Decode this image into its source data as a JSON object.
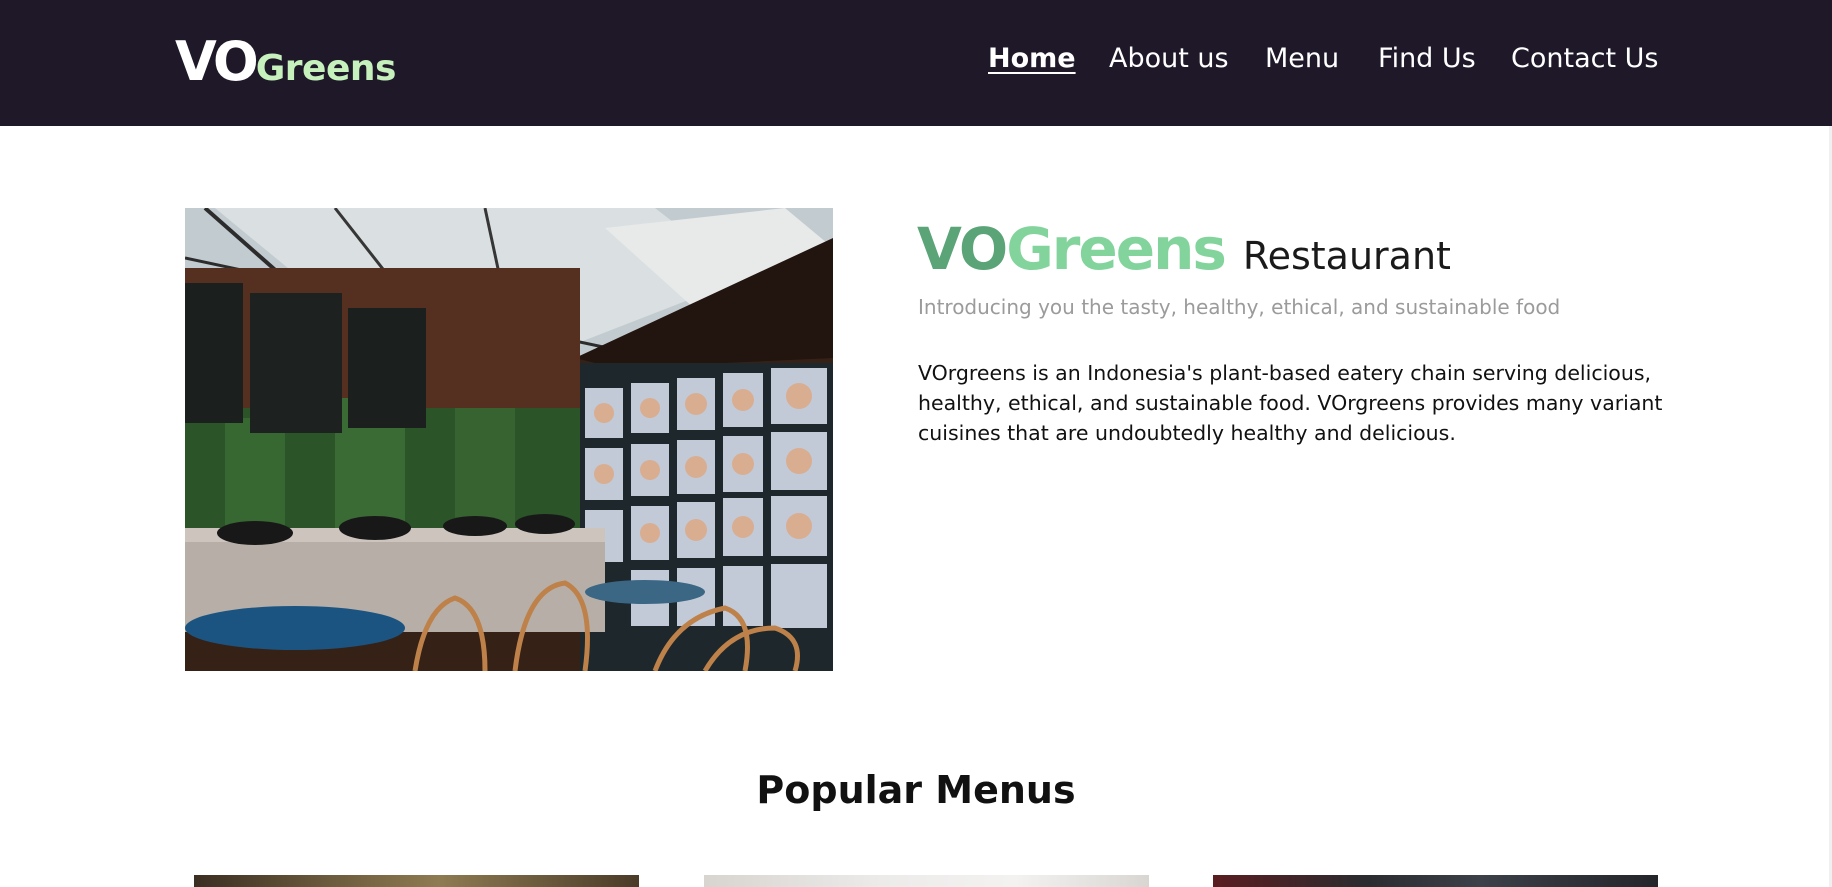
{
  "header": {
    "logo": {
      "part1": "VO",
      "part2": "Greens"
    },
    "nav": [
      {
        "label": "Home",
        "active": true
      },
      {
        "label": "About us",
        "active": false
      },
      {
        "label": "Menu",
        "active": false
      },
      {
        "label": "Find Us",
        "active": false
      },
      {
        "label": "Contact Us",
        "active": false
      }
    ]
  },
  "hero": {
    "title_part1": "VO",
    "title_part2": "Greens",
    "title_part3": "Restaurant",
    "subtitle": "Introducing you the tasty, healthy, ethical, and sustainable food",
    "description": "VOrgreens is an Indonesia's plant-based eatery chain serving delicious, healthy, ethical, and sustainable food. VOrgreens provides many variant cuisines that are undoubtedly healthy and delicious."
  },
  "popular": {
    "title": "Popular Menus"
  },
  "colors": {
    "navbar_bg": "#1e1829",
    "logo_accent": "#c6f1bd",
    "title_green_dark": "#5aa477",
    "title_green_light": "#83d49c",
    "subtitle_gray": "#9b9b9b"
  }
}
